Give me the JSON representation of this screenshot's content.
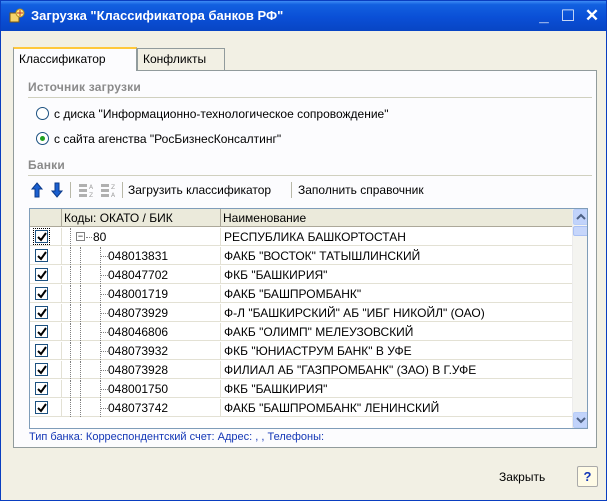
{
  "window": {
    "title": "Загрузка \"Классификатора банков РФ\"",
    "minimize_glyph": "_",
    "maximize_glyph": "□",
    "close_glyph": "✕"
  },
  "tabs": [
    {
      "label": "Классификатор",
      "active": true
    },
    {
      "label": "Конфликты",
      "active": false
    }
  ],
  "source_group": {
    "title": "Источник загрузки",
    "options": [
      {
        "label": "с диска \"Информационно-технологическое сопровождение\"",
        "selected": false
      },
      {
        "label": "с сайта агенства \"РосБизнесКонсалтинг\"",
        "selected": true
      }
    ]
  },
  "banks_group": {
    "title": "Банки"
  },
  "toolbar": {
    "load_label": "Загрузить классификатор",
    "fill_label": "Заполнить справочник"
  },
  "grid": {
    "columns": [
      "Коды: ОКАТО / БИК",
      "Наименование"
    ],
    "rows": [
      {
        "code": "80",
        "name": "РЕСПУБЛИКА БАШКОРТОСТАН",
        "checked": true,
        "level": 0
      },
      {
        "code": "048013831",
        "name": "ФАКБ \"ВОСТОК\"  ТАТЫШЛИНСКИЙ",
        "checked": true,
        "level": 1
      },
      {
        "code": "048047702",
        "name": "ФКБ \"БАШКИРИЯ\"",
        "checked": true,
        "level": 1
      },
      {
        "code": "048001719",
        "name": "ФАКБ \"БАШПРОМБАНК\"",
        "checked": true,
        "level": 1
      },
      {
        "code": "048073929",
        "name": "Ф-Л \"БАШКИРСКИЙ\" АБ \"ИБГ НИКОЙЛ\" (ОАО)",
        "checked": true,
        "level": 1
      },
      {
        "code": "048046806",
        "name": "ФАКБ \"ОЛИМП\"  МЕЛЕУЗОВСКИЙ",
        "checked": true,
        "level": 1
      },
      {
        "code": "048073932",
        "name": "ФКБ \"ЮНИАСТРУМ БАНК\" В УФЕ",
        "checked": true,
        "level": 1
      },
      {
        "code": "048073928",
        "name": "ФИЛИАЛ АБ \"ГАЗПРОМБАНК\" (ЗАО) В Г.УФЕ",
        "checked": true,
        "level": 1
      },
      {
        "code": "048001750",
        "name": "ФКБ \"БАШКИРИЯ\"",
        "checked": true,
        "level": 1
      },
      {
        "code": "048073742",
        "name": "ФАКБ \"БАШПРОМБАНК\" ЛЕНИНСКИЙ",
        "checked": true,
        "level": 1
      }
    ]
  },
  "info": {
    "text": "Тип банка:   Корреспондентский счет:   Адрес:  , , Телефоны:"
  },
  "footer": {
    "close_label": "Закрыть",
    "help_label": "?"
  },
  "colors": {
    "titlebar": "#0a4fd6",
    "window_bg": "#f2f0e4",
    "info_text": "#1437b6",
    "radio_dot": "#21a121"
  }
}
